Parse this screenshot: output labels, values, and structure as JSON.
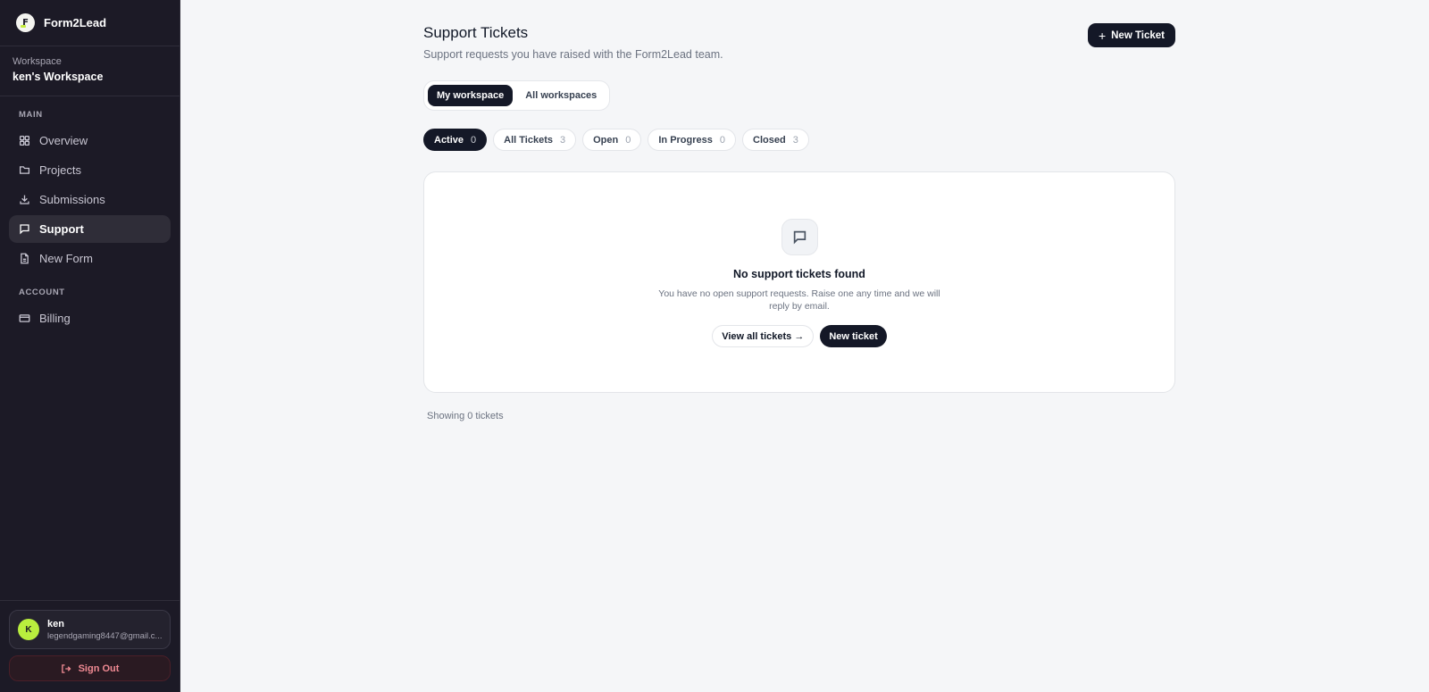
{
  "sidebar": {
    "brand": {
      "name": "Form2Lead",
      "logo_letter": "F"
    },
    "workspace": {
      "label": "Workspace",
      "name": "ken's Workspace"
    },
    "sections": {
      "main": "MAIN",
      "account": "ACCOUNT"
    },
    "main_items": [
      {
        "label": "Overview",
        "icon": "grid-icon",
        "active": false
      },
      {
        "label": "Projects",
        "icon": "folder-icon",
        "active": false
      },
      {
        "label": "Submissions",
        "icon": "download-icon",
        "active": false
      },
      {
        "label": "Support",
        "icon": "chat-icon",
        "active": true
      },
      {
        "label": "New Form",
        "icon": "file-icon",
        "active": false
      }
    ],
    "account_items": [
      {
        "label": "Billing",
        "icon": "credit-card-icon",
        "active": false
      }
    ],
    "user": {
      "initial": "K",
      "name": "ken",
      "email": "legendgaming8447@gmail.c..."
    },
    "sign_out_label": "Sign Out"
  },
  "header": {
    "title": "Support Tickets",
    "subtitle": "Support requests you have raised with the Form2Lead team.",
    "new_ticket_label": "New Ticket"
  },
  "workspace_toggle": {
    "options": [
      "My workspace",
      "All workspaces"
    ],
    "selected": "My workspace"
  },
  "filters": [
    {
      "label": "Active",
      "count": "0",
      "active": true
    },
    {
      "label": "All Tickets",
      "count": "3",
      "active": false
    },
    {
      "label": "Open",
      "count": "0",
      "active": false
    },
    {
      "label": "In Progress",
      "count": "0",
      "active": false
    },
    {
      "label": "Closed",
      "count": "3",
      "active": false
    }
  ],
  "empty_state": {
    "title": "No support tickets found",
    "text": "You have no open support requests. Raise one any time and we will reply by email.",
    "view_all_label": "View all tickets →",
    "new_ticket_label": "New ticket"
  },
  "footer_text": "Showing 0 tickets",
  "colors": {
    "sidebar_bg": "#1c1a26",
    "accent_dark": "#141827",
    "avatar_green": "#b9ee3e",
    "signout_red": "#f08a93"
  }
}
